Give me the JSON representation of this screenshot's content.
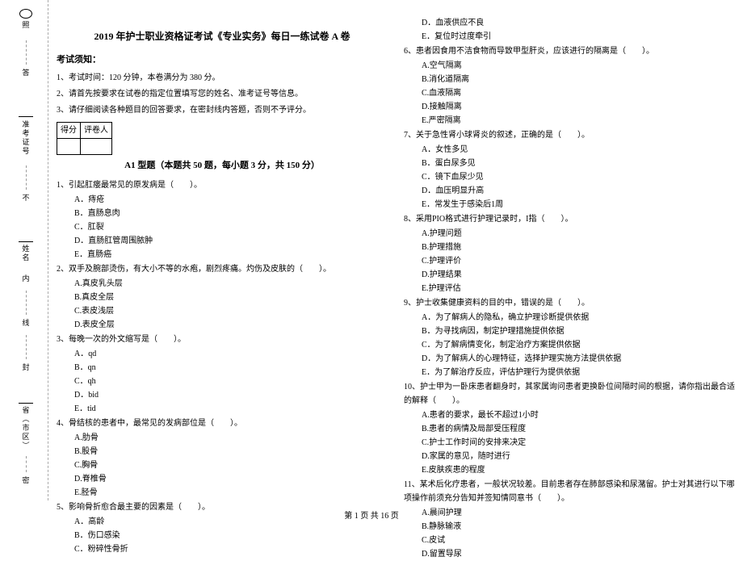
{
  "sidebar": {
    "labels": [
      "照",
      "答",
      "准考证号",
      "不",
      "姓名",
      "内",
      "线",
      "封",
      "省（市区）",
      "密"
    ]
  },
  "title": "2019 年护士职业资格证考试《专业实务》每日一练试卷 A 卷",
  "notice_heading": "考试须知：",
  "instructions": [
    "1、考试时间：120 分钟，本卷满分为 380 分。",
    "2、请首先按要求在试卷的指定位置填写您的姓名、准考证号等信息。",
    "3、请仔细阅读各种题目的回答要求，在密封线内答题，否则不予评分。"
  ],
  "score_table": {
    "c1": "得分",
    "c2": "评卷人"
  },
  "part_title": "A1 型题（本题共 50 题，每小题 3 分，共 150 分）",
  "left_questions": [
    {
      "stem": "1、引起肛瘘最常见的原发病是（　　）。",
      "opts": [
        "A．痔疮",
        "B．直肠息肉",
        "C．肛裂",
        "D．直肠肛管周围脓肿",
        "E．直肠癌"
      ]
    },
    {
      "stem": "2、双手及腕部烫伤，有大小不等的水疱，剧烈疼痛。灼伤及皮肤的（　　）。",
      "opts": [
        "A.真皮乳头层",
        "B.真皮全层",
        "C.表皮浅层",
        "D.表皮全层"
      ]
    },
    {
      "stem": "3、每晚一次的外文缩写是（　　）。",
      "opts": [
        "A．qd",
        "B．qn",
        "C．qh",
        "D．bid",
        "E．tid"
      ]
    },
    {
      "stem": "4、骨结核的患者中，最常见的发病部位是（　　）。",
      "opts": [
        "A.肋骨",
        "B.股骨",
        "C.胸骨",
        "D.脊椎骨",
        "E.胫骨"
      ]
    },
    {
      "stem": "5、影响骨折愈合最主要的因素是（　　）。",
      "opts": [
        "A．高龄",
        "B．伤口感染",
        "C．粉碎性骨折"
      ]
    }
  ],
  "right_questions_pre": [
    "D．血液供应不良",
    "E．复位时过度牵引"
  ],
  "right_questions": [
    {
      "stem": "6、患者因食用不洁食物而导致甲型肝炎，应该进行的隔离是（　　）。",
      "opts": [
        "A.空气隔离",
        "B.消化道隔离",
        "C.血液隔离",
        "D.接触隔离",
        "E.严密隔离"
      ]
    },
    {
      "stem": "7、关于急性肾小球肾炎的叙述，正确的是（　　）。",
      "opts": [
        "A．女性多见",
        "B．蛋白尿多见",
        "C．镜下血尿少见",
        "D．血压明显升高",
        "E．常发生于感染后1周"
      ]
    },
    {
      "stem": "8、采用PIO格式进行护理记录时，I指（　　）。",
      "opts": [
        "A.护理问题",
        "B.护理措施",
        "C.护理评价",
        "D.护理结果",
        "E.护理评估"
      ]
    },
    {
      "stem": "9、护士收集健康资料的目的中，错误的是（　　）。",
      "opts": [
        "A．为了解病人的隐私，确立护理诊断提供依据",
        "B．为寻找病因，制定护理措施提供依据",
        "C．为了解病情变化，制定治疗方案提供依据",
        "D．为了解病人的心理特征，选择护理实施方法提供依据",
        "E．为了解治疗反应，评估护理行为提供依据"
      ]
    },
    {
      "stem": "10、护士甲为一卧床患者翻身时，其家属询问患者更换卧位间隔时间的根据，请你指出最合适的解释（　　）。",
      "opts": [
        "A.患者的要求，最长不超过1小时",
        "B.患者的病情及局部受压程度",
        "C.护士工作时间的安排来决定",
        "D.家属的意见，随时进行",
        "E.皮肤疾患的程度"
      ]
    },
    {
      "stem": "11、某术后化疗患者，一般状况较差。目前患者存在肺部感染和尿潴留。护士对其进行以下哪项操作前须充分告知并签知情同意书（　　）。",
      "opts": [
        "A.晨间护理",
        "B.静脉输液",
        "C.皮试",
        "D.留置导尿"
      ]
    }
  ],
  "footer": "第 1 页 共 16 页"
}
